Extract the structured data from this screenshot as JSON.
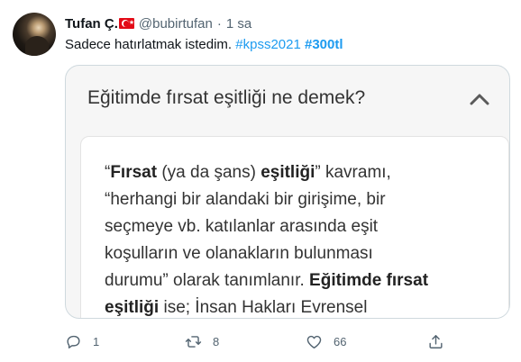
{
  "tweet": {
    "author": {
      "name": "Tufan Ç.",
      "flag_icon": "turkey-flag-icon",
      "handle": "@bubirtufan",
      "separator": "·",
      "time": "1 sa"
    },
    "text": {
      "body": "Sadece hatırlatmak istedim.",
      "hashtags": [
        "#kpss2021",
        "#300tl"
      ]
    },
    "media": {
      "title": "Eğitimde fırsat eşitliği ne demek?",
      "chevron_icon": "chevron-up-icon",
      "lines": [
        [
          {
            "t": "“",
            "b": false
          },
          {
            "t": "Fırsat",
            "b": true
          },
          {
            "t": " (ya da şans) ",
            "b": false
          },
          {
            "t": "eşitliği",
            "b": true
          },
          {
            "t": "” kavramı,",
            "b": false
          }
        ],
        [
          {
            "t": "“herhangi bir alandaki bir girişime, bir",
            "b": false
          }
        ],
        [
          {
            "t": "seçmeye vb. katılanlar arasında eşit",
            "b": false
          }
        ],
        [
          {
            "t": "koşulların ve olanakların bulunması",
            "b": false
          }
        ],
        [
          {
            "t": "durumu” olarak tanımlanır. ",
            "b": false
          },
          {
            "t": "Eğitimde fırsat",
            "b": true
          }
        ],
        [
          {
            "t": "eşitliği",
            "b": true
          },
          {
            "t": " ise; İnsan Hakları Evrensel",
            "b": false
          }
        ]
      ]
    },
    "actions": {
      "reply": {
        "icon": "reply-icon",
        "count": "1"
      },
      "retweet": {
        "icon": "retweet-icon",
        "count": "8"
      },
      "like": {
        "icon": "heart-icon",
        "count": "66"
      },
      "share": {
        "icon": "share-icon"
      }
    },
    "colors": {
      "link": "#1d9bf0",
      "secondary_text": "#536471",
      "border": "#cfd9de"
    }
  }
}
